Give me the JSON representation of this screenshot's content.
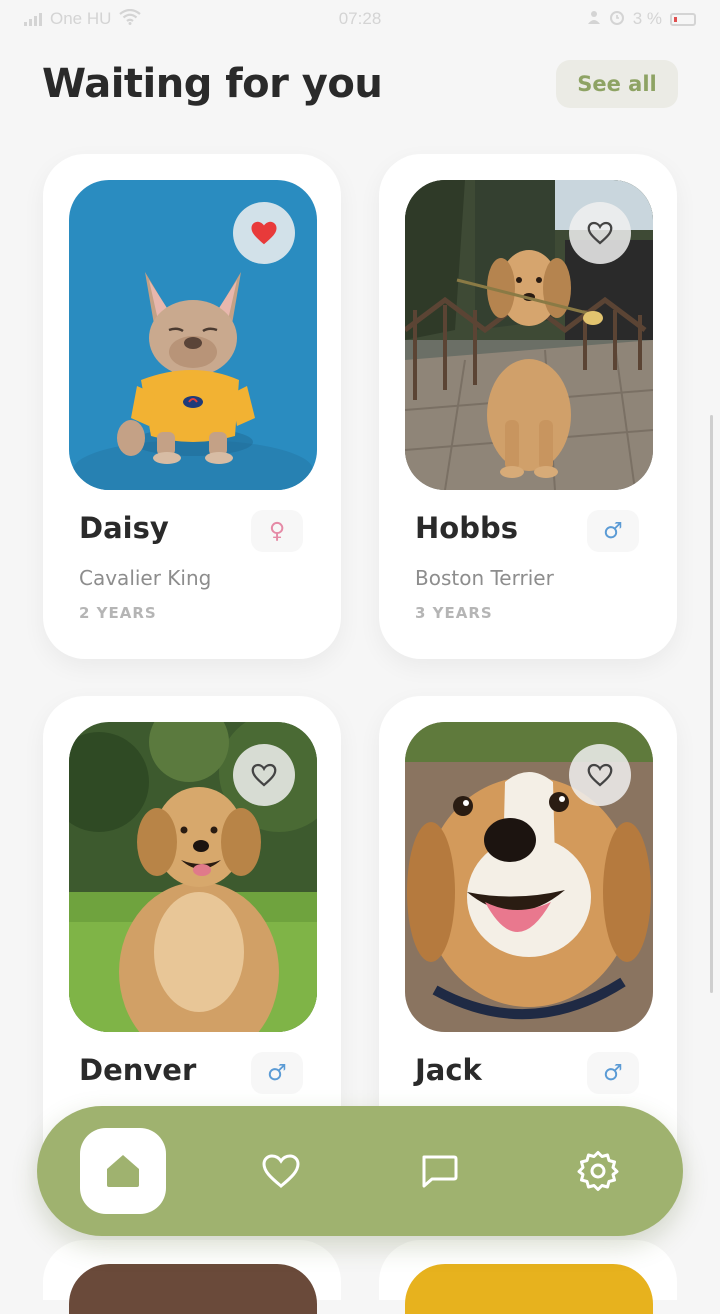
{
  "status_bar": {
    "carrier": "One HU",
    "time": "07:28",
    "battery": "3 %"
  },
  "header": {
    "title": "Waiting for you",
    "see_all_label": "See all"
  },
  "pets": [
    {
      "name": "Daisy",
      "breed": "Cavalier King",
      "age": "2 YEARS",
      "gender": "♀",
      "favorited": true
    },
    {
      "name": "Hobbs",
      "breed": "Boston Terrier",
      "age": "3 YEARS",
      "gender": "♂",
      "favorited": false
    },
    {
      "name": "Denver",
      "gender": "♂",
      "favorited": false
    },
    {
      "name": "Jack",
      "gender": "♂",
      "favorited": false
    }
  ],
  "nav": {
    "items": [
      {
        "icon": "home-icon",
        "active": true
      },
      {
        "icon": "heart-icon",
        "active": false
      },
      {
        "icon": "chat-icon",
        "active": false
      },
      {
        "icon": "settings-icon",
        "active": false
      }
    ]
  },
  "colors": {
    "accent": "#9fb26f",
    "see_all_text": "#8ea364",
    "heart_active": "#e83a3a",
    "female": "#e58aa6",
    "male": "#5b9bd5"
  }
}
